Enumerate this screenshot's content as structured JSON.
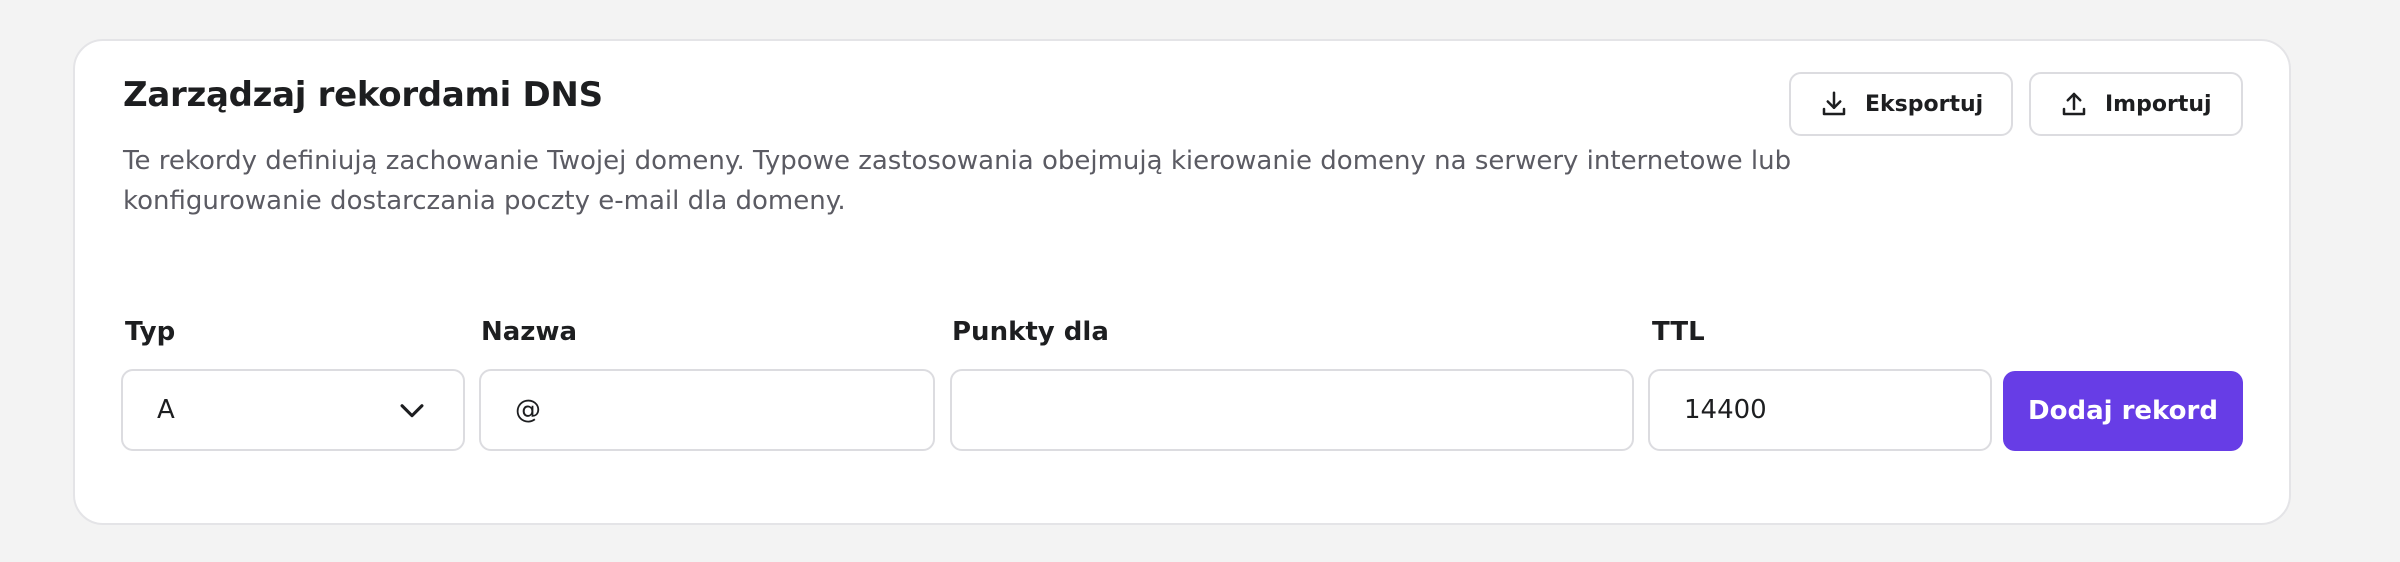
{
  "header": {
    "title": "Zarządzaj rekordami DNS",
    "description": "Te rekordy definiują zachowanie Twojej domeny. Typowe zastosowania obejmują kierowanie domeny na serwery internetowe lub konfigurowanie dostarczania poczty e-mail dla domeny."
  },
  "actions": {
    "export_label": "Eksportuj",
    "export_icon": "download-icon",
    "import_label": "Importuj",
    "import_icon": "upload-icon"
  },
  "form": {
    "type": {
      "label": "Typ",
      "value": "A",
      "icon": "chevron-down-icon"
    },
    "name": {
      "label": "Nazwa",
      "value": "@"
    },
    "points_to": {
      "label": "Punkty dla",
      "value": ""
    },
    "ttl": {
      "label": "TTL",
      "value": "14400"
    },
    "submit_label": "Dodaj rekord"
  },
  "colors": {
    "accent": "#673de6",
    "background": "#f3f3f3",
    "card": "#ffffff",
    "border": "#dcdce0",
    "text": "#1d1e20",
    "muted_text": "#5b5b63"
  }
}
